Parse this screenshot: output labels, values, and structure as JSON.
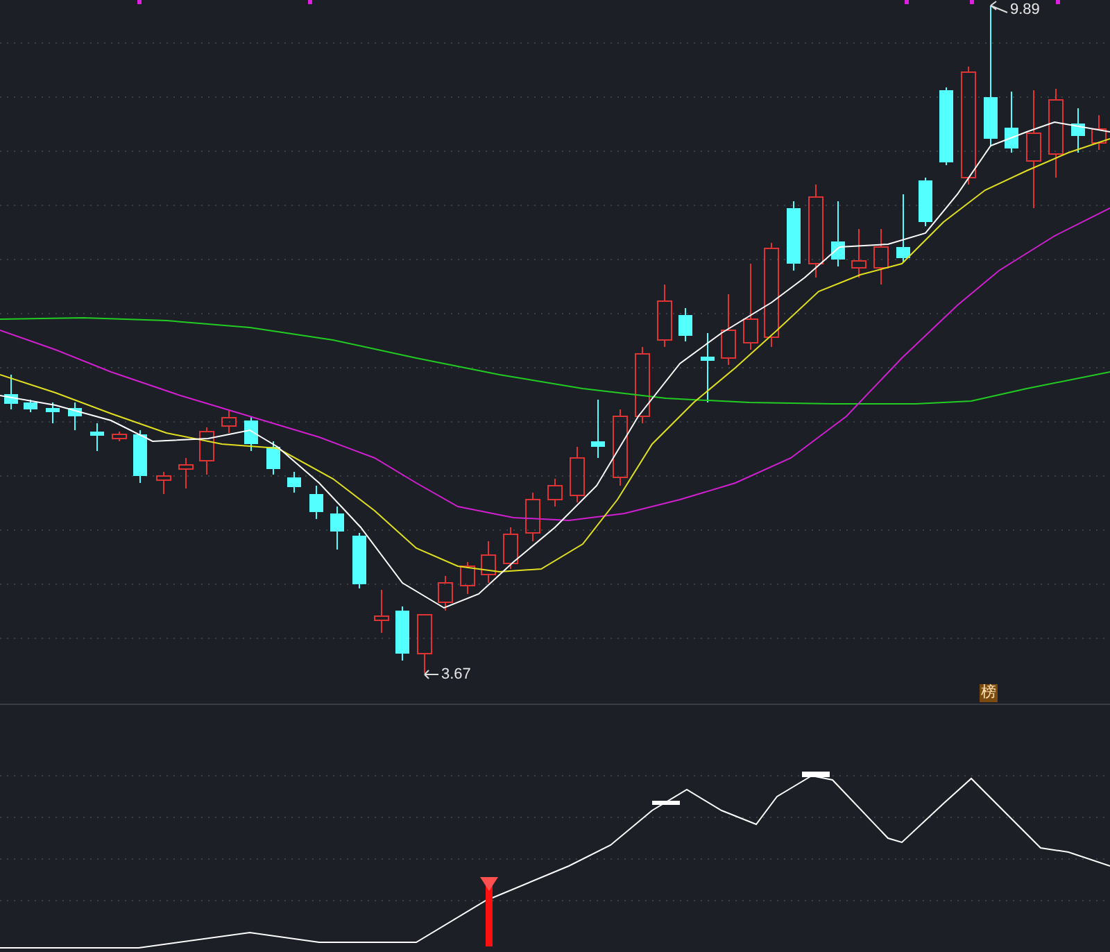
{
  "price_chart": {
    "high_label": "9.89",
    "low_label": "3.67",
    "badge": "榜"
  }
}
